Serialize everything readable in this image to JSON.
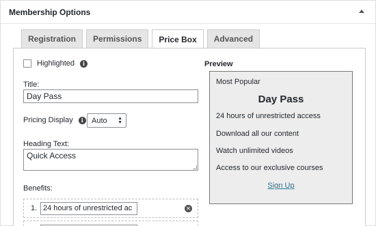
{
  "panel": {
    "title": "Membership Options"
  },
  "tabs": [
    {
      "label": "Registration"
    },
    {
      "label": "Permissions"
    },
    {
      "label": "Price Box"
    },
    {
      "label": "Advanced"
    }
  ],
  "form": {
    "highlighted_label": "Highlighted",
    "title_label": "Title:",
    "title_value": "Day Pass",
    "pricing_display_label": "Pricing Display",
    "pricing_display_value": "Auto",
    "heading_label": "Heading Text:",
    "heading_value": "Quick Access",
    "benefits_label": "Benefits:",
    "benefits": [
      {
        "num": "1.",
        "value": "24 hours of unrestricted ac"
      }
    ]
  },
  "preview": {
    "label": "Preview",
    "badge": "Most Popular",
    "title": "Day Pass",
    "items": [
      "24 hours of unrestricted access",
      "Download all our content",
      "Watch unlimited videos",
      "Access to our exclusive courses"
    ],
    "button": "Sign Up"
  },
  "icons": {
    "info": "info-icon",
    "remove": "remove-icon",
    "collapse": "collapse-icon"
  }
}
